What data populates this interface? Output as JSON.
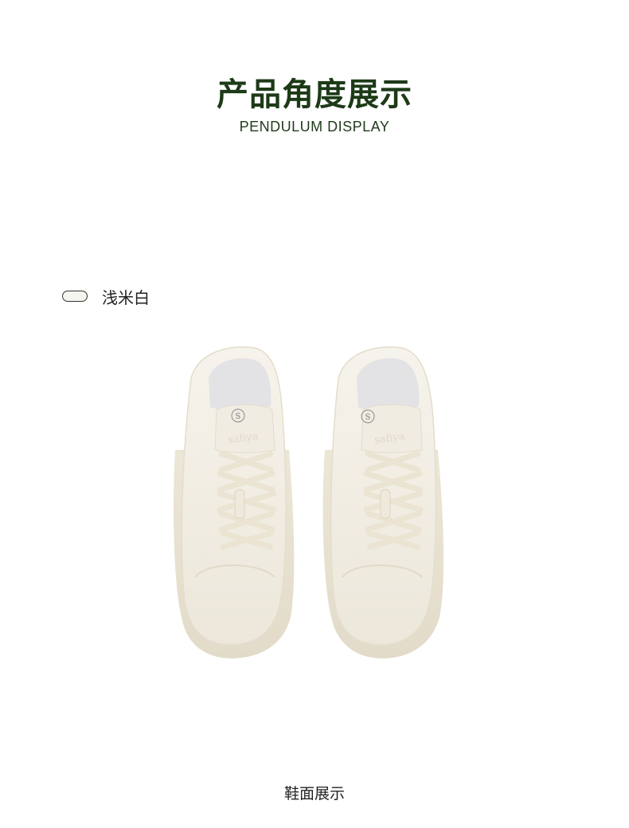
{
  "header": {
    "title": "产品角度展示",
    "subtitle": "PENDULUM DISPLAY"
  },
  "color_option": {
    "label": "浅米白",
    "swatch_color": "#f6f4ef"
  },
  "product_image": {
    "icon": "sneaker-pair-image",
    "brand_mark": "S",
    "emboss_text": "safiya"
  },
  "caption": "鞋面展示",
  "colors": {
    "title": "#1d3a17",
    "shoe": "#f1ede3",
    "lace": "#ece6d6"
  }
}
